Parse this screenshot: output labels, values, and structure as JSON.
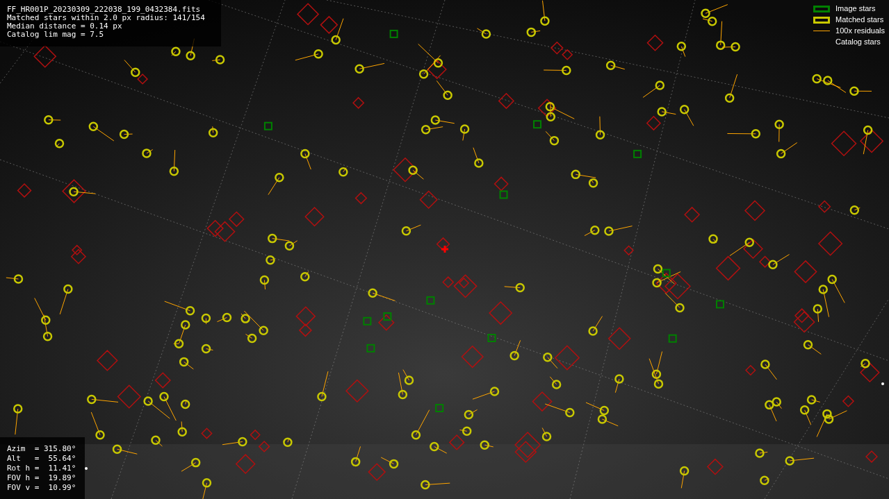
{
  "info_box": {
    "lines": [
      "FF_HR001P_20230309_222038_199_0432384.fits",
      "Matched stars within 2.0 px radius: 141/154",
      "Median distance = 0.14 px",
      "Catalog lim mag = 7.5"
    ]
  },
  "legend": [
    {
      "label": "Image stars"
    },
    {
      "kind": "matched",
      "label": "Matched stars"
    },
    {
      "kind": "residual",
      "label": "100x residuals"
    },
    {
      "kind": "catalog",
      "label": "Catalog stars"
    }
  ],
  "pointing_box": {
    "lines": [
      "Azim  = 315.80°",
      "Alt   =  55.64°",
      "Rot h =  11.41°",
      "FOV h =  19.89°",
      "FOV v =  10.99°"
    ]
  }
}
